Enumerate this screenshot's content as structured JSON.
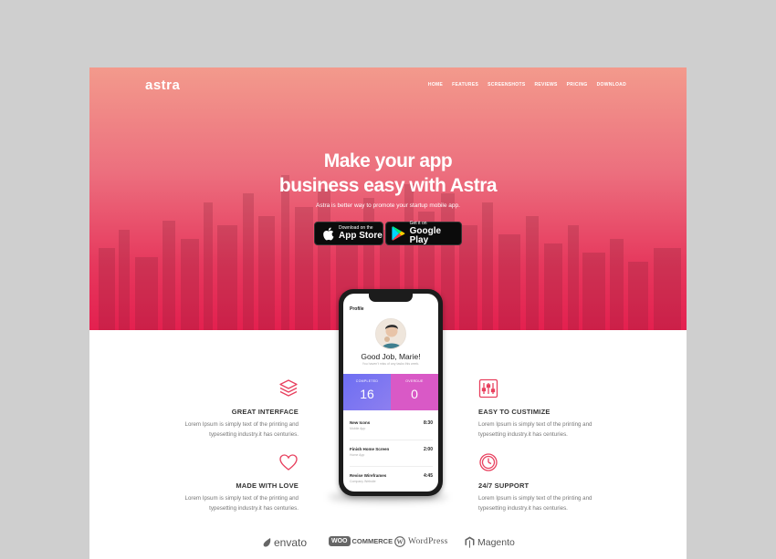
{
  "brand": {
    "logo": "astra"
  },
  "nav": {
    "items": [
      "HOME",
      "FEATURES",
      "SCREENSHOTS",
      "REVIEWS",
      "PRICING",
      "DOWNLOAD"
    ]
  },
  "hero": {
    "headline_line1": "Make your app",
    "headline_line2": "business easy with Astra",
    "subtitle": "Astra is better way to promote your startup mobile app.",
    "app_store": {
      "small": "Download on the",
      "big": "App Store"
    },
    "google_play": {
      "small": "Get it on",
      "big": "Google Play"
    }
  },
  "phone": {
    "profile_title": "Profile",
    "greeting": "Good Job, Marie!",
    "greeting_sub": "You haven't miss of any tasks this week.",
    "stats": [
      {
        "label": "COMPLETED",
        "value": "16"
      },
      {
        "label": "OVERDUE",
        "value": "0"
      }
    ],
    "tasks": [
      {
        "name": "New Icons",
        "category": "Mobile App",
        "time": "8:30"
      },
      {
        "name": "Finish Home Screen",
        "category": "Home App",
        "time": "2:00"
      },
      {
        "name": "Revise Wireframes",
        "category": "Company Website",
        "time": "4:45"
      }
    ]
  },
  "features": {
    "great_interface": {
      "title": "GREAT INTERFACE",
      "line1": "Lorem Ipsum is simply text of the printing and",
      "line2": "typesetting industry.it has centuries."
    },
    "made_with_love": {
      "title": "MADE WITH LOVE",
      "line1": "Lorem Ipsum is simply text of the printing and",
      "line2": "typesetting industry.it has centuries."
    },
    "easy_customize": {
      "title": "EASY TO CUSTIMIZE",
      "line1": "Lorem Ipsum is simply text of the printing and",
      "line2": "typesetting industry.it has centuries."
    },
    "support": {
      "title": "24/7 SUPPORT",
      "line1": "Lorem Ipsum is simply text of the printing and",
      "line2": "typesetting industry.it has centuries."
    }
  },
  "brands": {
    "envato": "envato",
    "woo_a": "WOO",
    "woo_b": "COMMERCE",
    "wordpress": "WordPress",
    "magento": "Magento"
  },
  "colors": {
    "accent": "#e4204f",
    "hero_top": "#f39a8c"
  }
}
